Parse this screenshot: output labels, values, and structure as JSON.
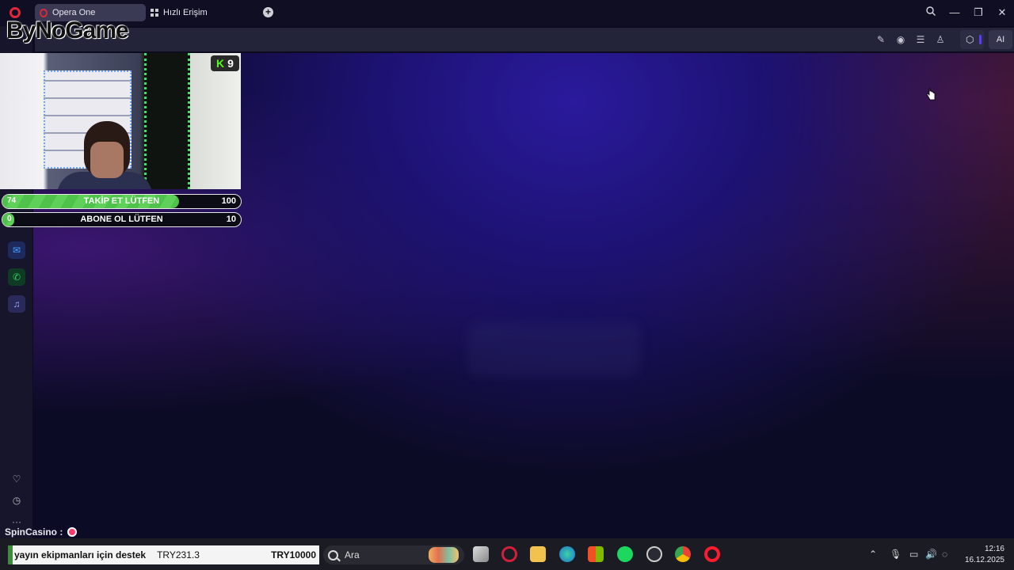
{
  "browser": {
    "tabs": [
      {
        "label": "Opera One",
        "active": true
      },
      {
        "label": "Hızlı Erişim",
        "active": false
      }
    ],
    "new_tab_icon": "plus-icon",
    "window_controls": {
      "search": "search-icon",
      "minimize": "minimize-icon",
      "restore": "restore-icon",
      "close": "close-icon"
    },
    "ai_label": "AI",
    "toolbar_icons": [
      "edit-icon",
      "camera-icon",
      "menu-icon",
      "account-icon",
      "cube-icon"
    ]
  },
  "overlay": {
    "logo_text": "ByNoGame",
    "kick_badge": {
      "letter": "K",
      "count": "9"
    },
    "goals": [
      {
        "current": "74",
        "label": "TAKİP ET LÜTFEN",
        "max": "100",
        "progress": 0.74
      },
      {
        "current": "0",
        "label": "ABONE OL LÜTFEN",
        "max": "10",
        "progress": 0.0
      }
    ],
    "chat": {
      "user": "SpinCasino :"
    }
  },
  "sidebar": {
    "items": [
      "messenger-icon",
      "whatsapp-icon",
      "music-icon"
    ],
    "bottom": [
      "heart-icon",
      "history-icon",
      "more-icon"
    ]
  },
  "taskbar": {
    "ticker": {
      "text": "yayın ekipmanları için destek",
      "amount": "TRY231.3",
      "goal": "TRY10000"
    },
    "search_placeholder": "Ara",
    "apps": [
      "task-view-icon",
      "opera-gx-icon",
      "file-explorer-icon",
      "edge-icon",
      "store-icon",
      "spotify-icon",
      "steam-icon",
      "chrome-icon",
      "opera-icon"
    ],
    "tray": [
      "chevron-up-icon",
      "mic-icon",
      "network-icon",
      "volume-icon",
      "notification-icon"
    ],
    "time": "12:16",
    "date": "16.12.2025"
  },
  "colors": {
    "accent": "#e0263a",
    "kick_green": "#53fc18",
    "goal_green": "#4ec24a"
  }
}
